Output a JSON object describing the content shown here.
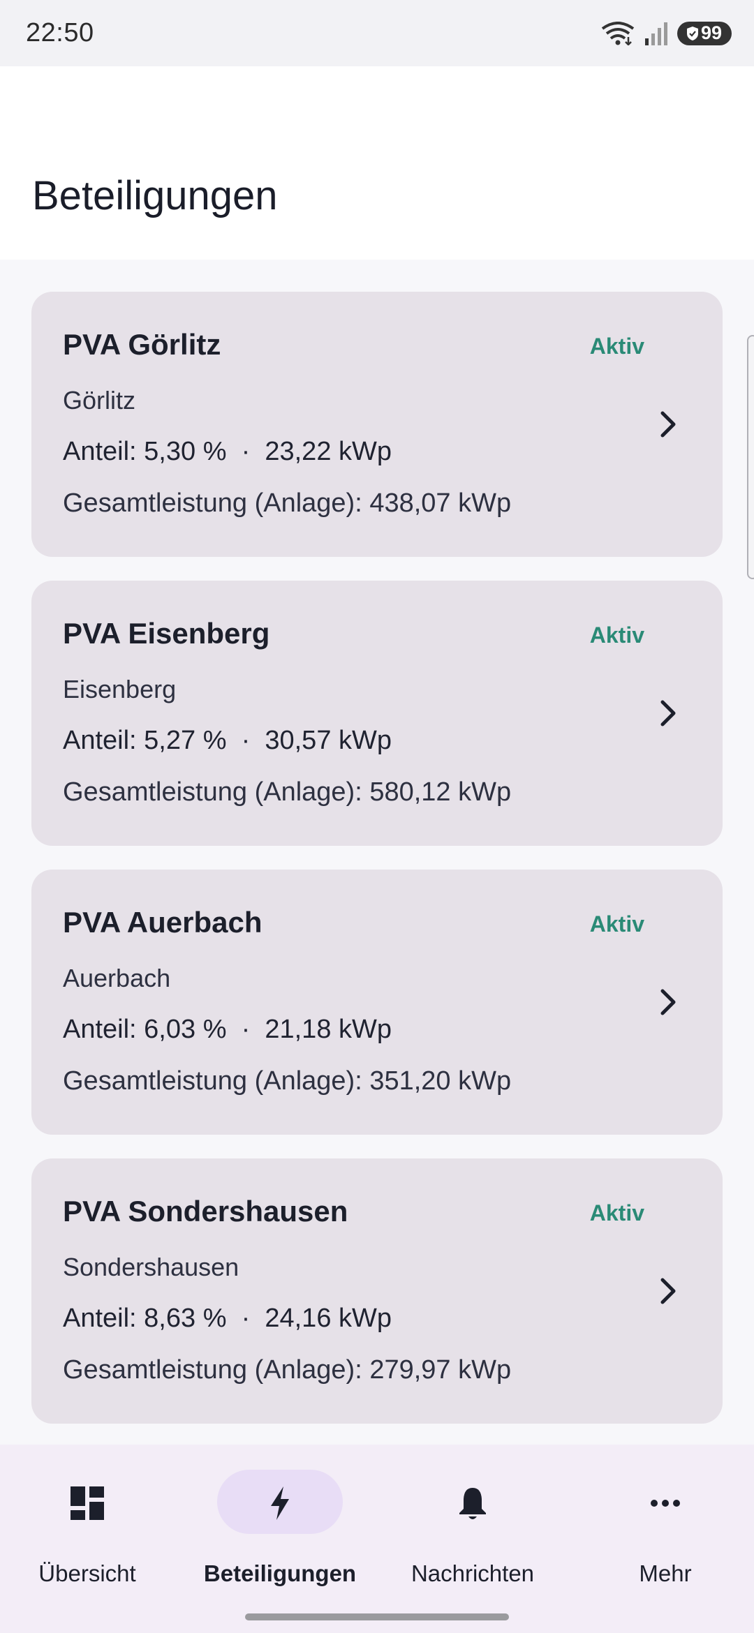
{
  "status_bar": {
    "time": "22:50",
    "battery": "99"
  },
  "header": {
    "title": "Beteiligungen"
  },
  "cards": [
    {
      "title": "PVA Görlitz",
      "status": "Aktiv",
      "location": "Görlitz",
      "share": "Anteil: 5,30 %  ·  23,22 kWp",
      "total": "Gesamtleistung (Anlage): 438,07 kWp"
    },
    {
      "title": "PVA Eisenberg",
      "status": "Aktiv",
      "location": "Eisenberg",
      "share": "Anteil: 5,27 %  ·  30,57 kWp",
      "total": "Gesamtleistung (Anlage): 580,12 kWp"
    },
    {
      "title": "PVA Auerbach",
      "status": "Aktiv",
      "location": "Auerbach",
      "share": "Anteil: 6,03 %  ·  21,18 kWp",
      "total": "Gesamtleistung (Anlage): 351,20 kWp"
    },
    {
      "title": "PVA Sondershausen",
      "status": "Aktiv",
      "location": "Sondershausen",
      "share": "Anteil: 8,63 %  ·  24,16 kWp",
      "total": "Gesamtleistung (Anlage): 279,97 kWp"
    }
  ],
  "nav": {
    "items": [
      {
        "label": "Übersicht",
        "icon": "dashboard-icon"
      },
      {
        "label": "Beteiligungen",
        "icon": "bolt-icon",
        "selected": true
      },
      {
        "label": "Nachrichten",
        "icon": "bell-icon"
      },
      {
        "label": "Mehr",
        "icon": "more-horizontal-icon"
      }
    ]
  },
  "colors": {
    "card_background": "#e6e1e8",
    "status_active": "#2a8a76",
    "nav_background": "#f3edf7",
    "nav_active_pill": "#e8ddf6"
  }
}
